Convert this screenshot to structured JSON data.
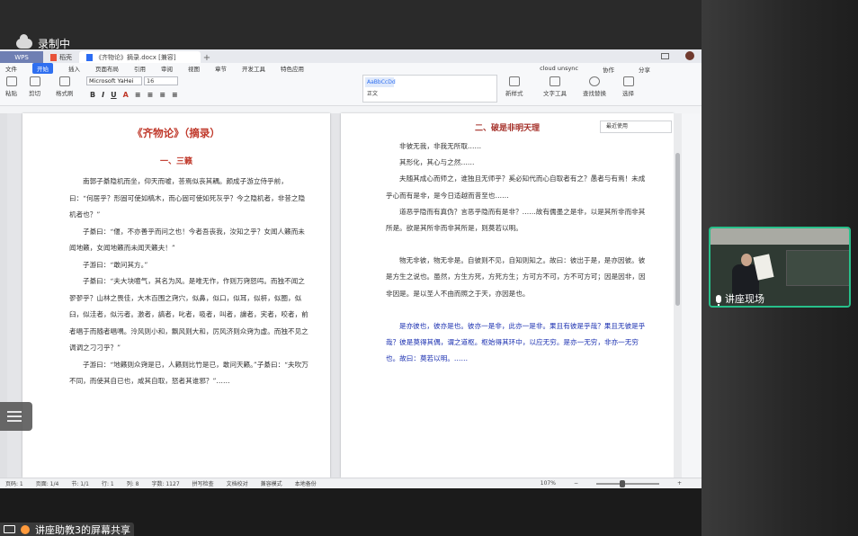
{
  "recording": {
    "label": "录制中"
  },
  "tabs": [
    {
      "label": "WPS"
    },
    {
      "label": "稻壳"
    },
    {
      "label": "《齐物论》摘录.docx [兼容]"
    }
  ],
  "menu": {
    "items": [
      "文件",
      "开始",
      "插入",
      "页面布局",
      "引用",
      "审阅",
      "视图",
      "章节",
      "开发工具",
      "特色应用"
    ],
    "active_index": 1,
    "right": [
      "cloud unsync",
      "分享",
      "协作"
    ]
  },
  "toolbar": {
    "paste": "粘贴",
    "cut": "剪切",
    "format_painter": "格式刷",
    "font_name": "Microsoft YaHei",
    "font_size": "16",
    "style_normal": "AaBbCcDd",
    "style_label": "正文",
    "new_style": "新样式",
    "text_tools": "文字工具",
    "find_replace": "查找替换",
    "select": "选择"
  },
  "recent": {
    "label": "最近使用"
  },
  "doc": {
    "page1": {
      "title": "《齐物论》（摘录）",
      "section": "一、三籁",
      "paras": [
        "南郭子綦隐机而坐，仰天而嘘，荅焉似丧其耦。颜成子游立侍乎前，曰：“何居乎？形固可使如槁木，而心固可使如死灰乎？今之隐机者，非昔之隐机者也？”",
        "子綦曰：“偃，不亦善乎而问之也！今者吾丧我，汝知之乎？女闻人籁而未闻地籁，女闻地籁而未闻天籁夫！”",
        "子游曰：“敢问其方。”",
        "子綦曰：“夫大块噫气，其名为风。是唯无作，作则万窍怒呺。而独不闻之翏翏乎？山林之畏佳，大木百围之窍穴，似鼻，似口，似耳，似枅，似圈，似臼，似洼者，似污者。激者，謞者，叱者，吸者，叫者，譹者，宎者，咬者，前者唱于而随者唱喁。泠风则小和，飘风则大和，厉风济则众窍为虚。而独不见之调调之刁刁乎？”",
        "子游曰：“地籁则众窍是已，人籁则比竹是已，敢问天籁。”子綦曰：“夫吹万不同，而使其自已也，咸其自取，怒者其谁邪？”……"
      ]
    },
    "page2": {
      "section": "二、破是非明天理",
      "paras": [
        "非彼无我，非我无所取……",
        "其形化，其心与之然……",
        "夫随其成心而师之，谁独且无师乎？奚必知代而心自取者有之？愚者与有焉！未成乎心而有是非，是今日适越而昔至也……",
        "道恶乎隐而有真伪？言恶乎隐而有是非？……故有儒墨之是非，以是其所非而非其所是。欲是其所非而非其所是，则莫若以明。",
        "物无非彼，物无非是。自彼则不见，自知则知之。故曰：彼出于是，是亦因彼。彼是方生之说也。虽然，方生方死，方死方生；方可方不可，方不可方可；因是因非，因非因是。是以圣人不由而照之于天，亦因是也。",
        "是亦彼也，彼亦是也。彼亦一是非，此亦一是非。果且有彼是乎哉？果且无彼是乎哉？彼是莫得其偶，谓之道枢。枢始得其环中，以应无穷。是亦一无穷，非亦一无穷也。故曰：莫若以明。……"
      ]
    }
  },
  "status": {
    "page": "页码: 1",
    "pages": "页面: 1/4",
    "section": "节: 1/1",
    "row": "行: 1",
    "col": "列: 8",
    "words": "字数: 1127",
    "spell": "拼写检查",
    "proof": "文档校对",
    "compat": "兼容模式",
    "backup": "本地备份",
    "zoom": "107%"
  },
  "camera": {
    "label": "讲座现场"
  },
  "screen_share": {
    "label": "讲座助教3的屏幕共享"
  }
}
